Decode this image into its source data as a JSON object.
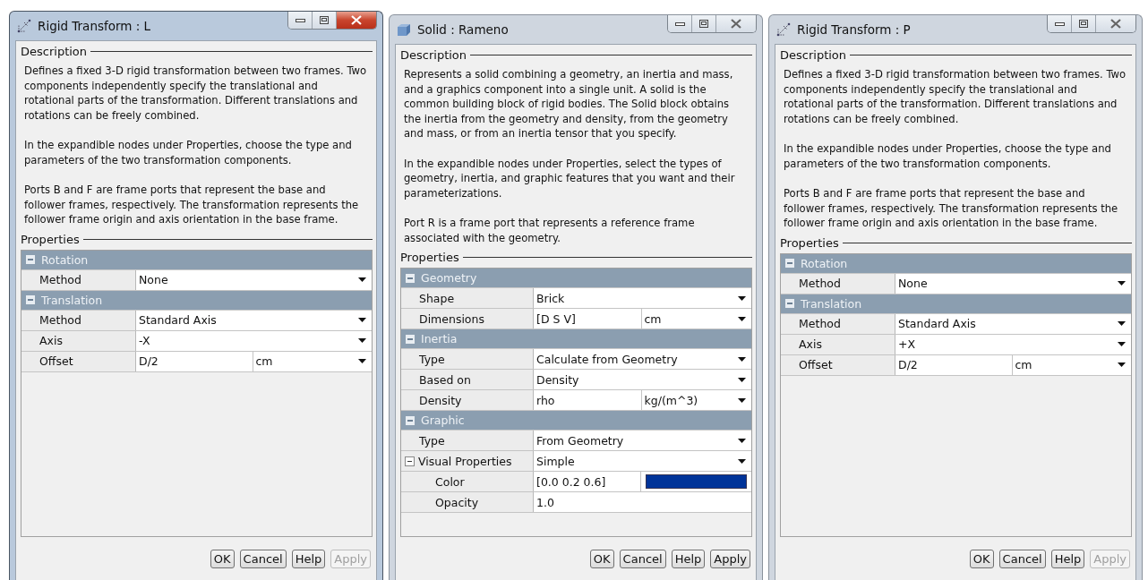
{
  "windows": [
    {
      "title": "Rigid Transform : L",
      "kind": "transform",
      "active": true,
      "description": {
        "heading": "Description",
        "paragraphs": [
          "Defines a fixed 3-D rigid transformation between two frames. Two components independently specify the translational and rotational parts of the transformation. Different translations and rotations can be freely combined.",
          "In the expandible nodes under Properties, choose the type and parameters of the two transformation components.",
          "Ports B and F are frame ports that represent the base and follower frames, respectively. The transformation represents the follower frame origin and axis orientation in the base frame."
        ]
      },
      "properties": {
        "heading": "Properties",
        "groups": [
          {
            "name": "Rotation",
            "expanded": true,
            "rows": [
              {
                "label": "Method",
                "kind": "select",
                "value": "None"
              }
            ]
          },
          {
            "name": "Translation",
            "expanded": true,
            "rows": [
              {
                "label": "Method",
                "kind": "select",
                "value": "Standard Axis"
              },
              {
                "label": "Axis",
                "kind": "select",
                "value": "-X"
              },
              {
                "label": "Offset",
                "kind": "value_unit",
                "value": "D/2",
                "unit": "cm"
              }
            ]
          }
        ]
      },
      "buttons": [
        {
          "label": "OK",
          "disabled": false
        },
        {
          "label": "Cancel",
          "disabled": false
        },
        {
          "label": "Help",
          "disabled": false
        },
        {
          "label": "Apply",
          "disabled": true
        }
      ]
    },
    {
      "title": "Solid : Rameno",
      "kind": "solid",
      "active": false,
      "description": {
        "heading": "Description",
        "paragraphs": [
          "Represents a solid combining a geometry, an inertia and mass, and a graphics component into a single unit. A solid is the common building block of rigid bodies. The Solid block obtains the inertia from the geometry and density, from the geometry and mass, or from an inertia tensor that you specify.",
          "In the expandible nodes under Properties, select the types of geometry, inertia, and graphic features that you want and their parameterizations.",
          "Port R is a frame port that represents a reference frame associated with the geometry."
        ]
      },
      "properties": {
        "heading": "Properties",
        "groups": [
          {
            "name": "Geometry",
            "expanded": true,
            "rows": [
              {
                "label": "Shape",
                "kind": "select",
                "value": "Brick"
              },
              {
                "label": "Dimensions",
                "kind": "value_unit",
                "value": "[D S V]",
                "unit": "cm"
              }
            ]
          },
          {
            "name": "Inertia",
            "expanded": true,
            "rows": [
              {
                "label": "Type",
                "kind": "select",
                "value": "Calculate from Geometry"
              },
              {
                "label": "Based on",
                "kind": "select",
                "value": "Density"
              },
              {
                "label": "Density",
                "kind": "value_unit",
                "value": "rho",
                "unit": "kg/(m^3)"
              }
            ]
          },
          {
            "name": "Graphic",
            "expanded": true,
            "rows": [
              {
                "label": "Type",
                "kind": "select",
                "value": "From Geometry"
              },
              {
                "label": "Visual Properties",
                "kind": "select",
                "value": "Simple",
                "expanded": true,
                "children": [
                  {
                    "label": "Color",
                    "kind": "color",
                    "value": "[0.0 0.2 0.6]",
                    "color": "#003399"
                  },
                  {
                    "label": "Opacity",
                    "kind": "text",
                    "value": "1.0"
                  }
                ]
              }
            ]
          }
        ]
      },
      "buttons": [
        {
          "label": "OK",
          "disabled": false
        },
        {
          "label": "Cancel",
          "disabled": false
        },
        {
          "label": "Help",
          "disabled": false
        },
        {
          "label": "Apply",
          "disabled": false
        }
      ]
    },
    {
      "title": "Rigid Transform : P",
      "kind": "transform",
      "active": false,
      "description": {
        "heading": "Description",
        "paragraphs": [
          "Defines a fixed 3-D rigid transformation between two frames. Two components independently specify the translational and rotational parts of the transformation. Different translations and rotations can be freely combined.",
          "In the expandible nodes under Properties, choose the type and parameters of the two transformation components.",
          "Ports B and F are frame ports that represent the base and follower frames, respectively. The transformation represents the follower frame origin and axis orientation in the base frame."
        ]
      },
      "properties": {
        "heading": "Properties",
        "groups": [
          {
            "name": "Rotation",
            "expanded": true,
            "rows": [
              {
                "label": "Method",
                "kind": "select",
                "value": "None"
              }
            ]
          },
          {
            "name": "Translation",
            "expanded": true,
            "rows": [
              {
                "label": "Method",
                "kind": "select",
                "value": "Standard Axis"
              },
              {
                "label": "Axis",
                "kind": "select",
                "value": "+X"
              },
              {
                "label": "Offset",
                "kind": "value_unit",
                "value": "D/2",
                "unit": "cm"
              }
            ]
          }
        ]
      },
      "buttons": [
        {
          "label": "OK",
          "disabled": false
        },
        {
          "label": "Cancel",
          "disabled": false
        },
        {
          "label": "Help",
          "disabled": false
        },
        {
          "label": "Apply",
          "disabled": true
        }
      ]
    }
  ]
}
